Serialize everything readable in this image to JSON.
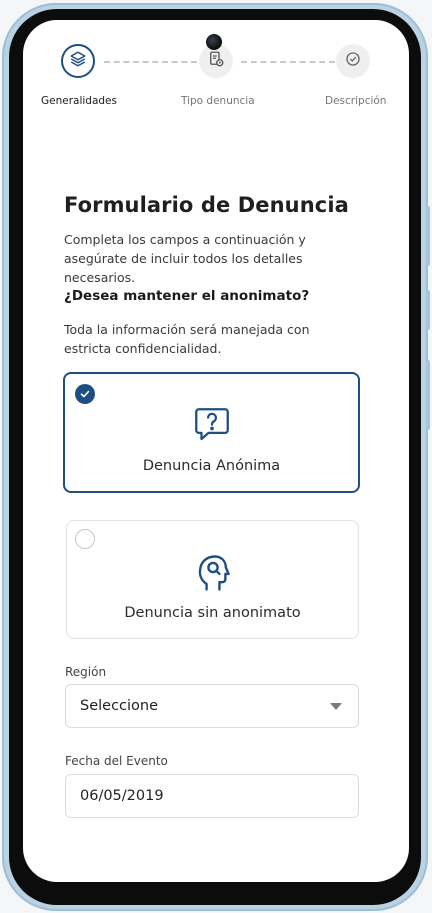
{
  "stepper": {
    "steps": [
      {
        "label": "Generalidades",
        "state": "active",
        "icon": "layers-icon"
      },
      {
        "label": "Tipo denuncia",
        "state": "pending",
        "icon": "document-clock-icon"
      },
      {
        "label": "Descripción",
        "state": "pending",
        "icon": "check-circle-icon"
      }
    ]
  },
  "form": {
    "title": "Formulario de Denuncia",
    "description": "Completa los campos a continuación y asegúrate de incluir todos los detalles necesarios.",
    "question": "¿Desea mantener el anonimato?",
    "note": "Toda la información será manejada con estricta confidencialidad."
  },
  "options": [
    {
      "label": "Denuncia Anónima",
      "selected": true,
      "icon": "question-bubble-icon"
    },
    {
      "label": "Denuncia sin anonimato",
      "selected": false,
      "icon": "head-search-icon"
    }
  ],
  "fields": {
    "region": {
      "label": "Región",
      "value": "Seleccione"
    },
    "date": {
      "label": "Fecha del Evento",
      "value": "06/05/2019"
    }
  },
  "colors": {
    "accent": "#1e4f82",
    "border": "#dcdcdc",
    "text": "#1f1f1f"
  }
}
